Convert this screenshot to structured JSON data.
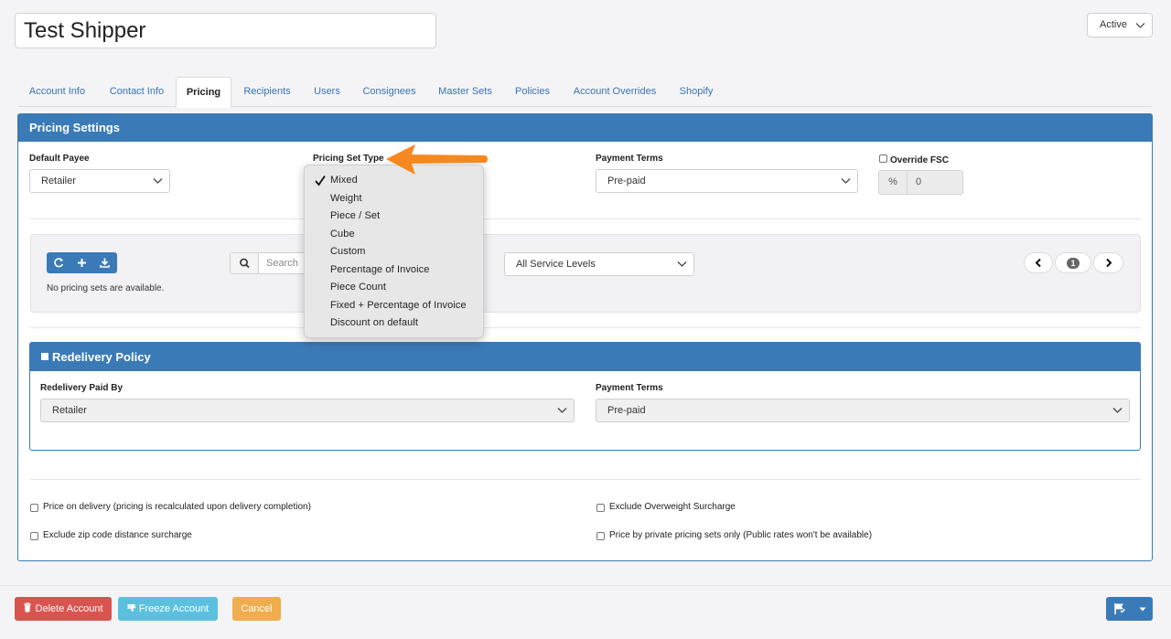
{
  "header": {
    "account_name": "Test Shipper",
    "status": "Active"
  },
  "tabs": [
    {
      "label": "Account Info"
    },
    {
      "label": "Contact Info"
    },
    {
      "label": "Pricing"
    },
    {
      "label": "Recipients"
    },
    {
      "label": "Users"
    },
    {
      "label": "Consignees"
    },
    {
      "label": "Master Sets"
    },
    {
      "label": "Policies"
    },
    {
      "label": "Account Overrides"
    },
    {
      "label": "Shopify"
    }
  ],
  "active_tab": "Pricing",
  "pricing_settings": {
    "title": "Pricing Settings",
    "default_payee_label": "Default Payee",
    "default_payee_value": "Retailer",
    "pricing_set_type_label": "Pricing Set Type",
    "payment_terms_label": "Payment Terms",
    "payment_terms_value": "Pre-paid",
    "override_fsc_label": "Override FSC",
    "fsc_addon": "%",
    "fsc_value": "0"
  },
  "pricing_set_type_menu": {
    "selected": "Mixed",
    "options": [
      "Mixed",
      "Weight",
      "Piece / Set",
      "Cube",
      "Custom",
      "Percentage of Invoice",
      "Piece Count",
      "Fixed + Percentage of Invoice",
      "Discount on default"
    ]
  },
  "pricing_sets": {
    "search_placeholder": "Search",
    "service_levels": "All Service Levels",
    "empty_message": "No pricing sets are available.",
    "page": "1"
  },
  "redelivery": {
    "title": "Redelivery Policy",
    "paid_by_label": "Redelivery Paid By",
    "paid_by_value": "Retailer",
    "payment_terms_label": "Payment Terms",
    "payment_terms_value": "Pre-paid"
  },
  "options": {
    "price_on_delivery": "Price on delivery (pricing is recalculated upon delivery completion)",
    "exclude_zip": "Exclude zip code distance surcharge",
    "exclude_overweight": "Exclude Overweight Surcharge",
    "private_only": "Price by private pricing sets only (Public rates won't be available)"
  },
  "footer": {
    "delete_label": "Delete Account",
    "freeze_label": "Freeze Account",
    "cancel_label": "Cancel"
  },
  "colors": {
    "primary": "#3a7ab6",
    "danger": "#d9534f",
    "info": "#5bc0de",
    "warning": "#f0ad4e",
    "arrow": "#f5891f"
  }
}
